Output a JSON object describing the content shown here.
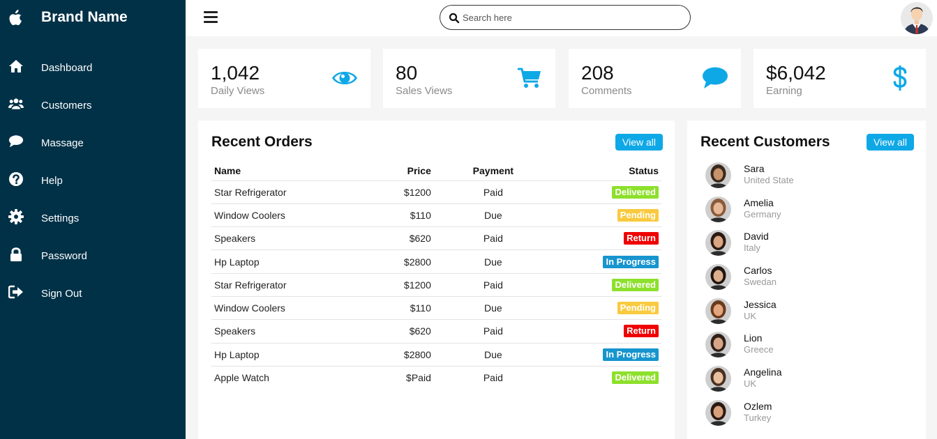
{
  "brand": {
    "name": "Brand Name",
    "logo_icon": "apple-icon"
  },
  "sidebar": {
    "items": [
      {
        "label": "Dashboard",
        "icon": "home-icon"
      },
      {
        "label": "Customers",
        "icon": "users-icon"
      },
      {
        "label": "Massage",
        "icon": "chat-icon"
      },
      {
        "label": "Help",
        "icon": "help-icon"
      },
      {
        "label": "Settings",
        "icon": "gear-icon"
      },
      {
        "label": "Password",
        "icon": "lock-icon"
      },
      {
        "label": "Sign Out",
        "icon": "sign-out-icon"
      }
    ]
  },
  "topbar": {
    "search_placeholder": "Search here",
    "menu_icon": "hamburger-icon"
  },
  "cards": [
    {
      "value": "1,042",
      "label": "Daily Views",
      "icon": "eye-icon"
    },
    {
      "value": "80",
      "label": "Sales Views",
      "icon": "cart-icon"
    },
    {
      "value": "208",
      "label": "Comments",
      "icon": "comment-icon"
    },
    {
      "value": "$6,042",
      "label": "Earning",
      "icon": "dollar-icon"
    }
  ],
  "colors": {
    "sidebar_bg": "#003147",
    "accent": "#0fa8e6",
    "delivered": "#8de02c",
    "pending": "#f9ca3f",
    "return": "#f00000",
    "in_progress": "#1795ce"
  },
  "orders": {
    "title": "Recent Orders",
    "view_all": "View all",
    "headers": {
      "name": "Name",
      "price": "Price",
      "payment": "Payment",
      "status": "Status"
    },
    "rows": [
      {
        "name": "Star Refrigerator",
        "price": "$1200",
        "payment": "Paid",
        "status": "Delivered",
        "status_color": "#8de02c"
      },
      {
        "name": "Window Coolers",
        "price": "$110",
        "payment": "Due",
        "status": "Pending",
        "status_color": "#f9ca3f"
      },
      {
        "name": "Speakers",
        "price": "$620",
        "payment": "Paid",
        "status": "Return",
        "status_color": "#f00000"
      },
      {
        "name": "Hp Laptop",
        "price": "$2800",
        "payment": "Due",
        "status": "In Progress",
        "status_color": "#1795ce"
      },
      {
        "name": "Star Refrigerator",
        "price": "$1200",
        "payment": "Paid",
        "status": "Delivered",
        "status_color": "#8de02c"
      },
      {
        "name": "Window Coolers",
        "price": "$110",
        "payment": "Due",
        "status": "Pending",
        "status_color": "#f9ca3f"
      },
      {
        "name": "Speakers",
        "price": "$620",
        "payment": "Paid",
        "status": "Return",
        "status_color": "#f00000"
      },
      {
        "name": "Hp Laptop",
        "price": "$2800",
        "payment": "Due",
        "status": "In Progress",
        "status_color": "#1795ce"
      },
      {
        "name": "Apple Watch",
        "price": "$Paid",
        "payment": "Paid",
        "status": "Delivered",
        "status_color": "#8de02c"
      }
    ]
  },
  "customers": {
    "title": "Recent Customers",
    "view_all": "View all",
    "items": [
      {
        "name": "Sara",
        "country": "United State",
        "skin": "#c8936b",
        "hair": "#3a2a1e"
      },
      {
        "name": "Amelia",
        "country": "Germany",
        "skin": "#e6b896",
        "hair": "#8a5a3a"
      },
      {
        "name": "David",
        "country": "Italy",
        "skin": "#d9a582",
        "hair": "#2a1a12"
      },
      {
        "name": "Carlos",
        "country": "Swedan",
        "skin": "#dcae8c",
        "hair": "#1e1410"
      },
      {
        "name": "Jessica",
        "country": "UK",
        "skin": "#e2a67c",
        "hair": "#6a3a1c"
      },
      {
        "name": "Lion",
        "country": "Greece",
        "skin": "#d7a587",
        "hair": "#2e2018"
      },
      {
        "name": "Angelina",
        "country": "UK",
        "skin": "#e8c0a0",
        "hair": "#4a3020"
      },
      {
        "name": "Ozlem",
        "country": "Turkey",
        "skin": "#d8a07a",
        "hair": "#2a1812"
      }
    ]
  }
}
